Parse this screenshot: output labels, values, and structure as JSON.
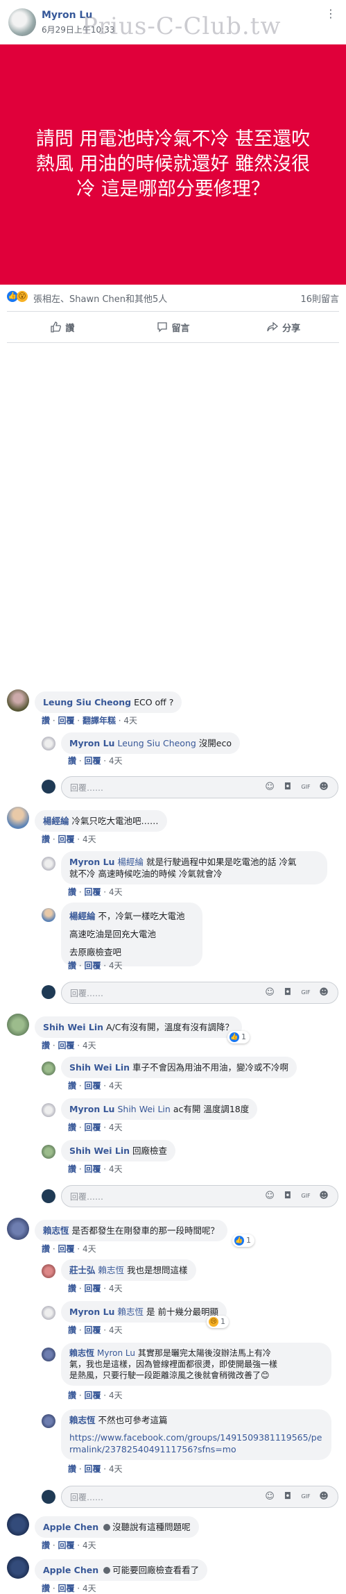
{
  "watermark": "Prius-C-Club.tw",
  "post": {
    "author": "Myron Lu",
    "time": "6月29日上午10:33",
    "text": "請問 用電池時冷氣不冷 甚至還吹熱風 用油的時候就還好 雖然沒很冷 這是哪部分要修理？",
    "bg_color": "#e0003a"
  },
  "reactions": {
    "names": "張相左、Shawn Chen和其他5人",
    "comment_count": "16則留言"
  },
  "actions": {
    "like": "讚",
    "comment": "留言",
    "share": "分享"
  },
  "labels": {
    "like": "讚",
    "reply": "回覆",
    "translate": "翻譯年糕",
    "dot": "·",
    "reply_placeholder": "回覆……"
  },
  "comments": [
    {
      "author": "Leung Siu Cheong",
      "text": "ECO off ?",
      "time": "4天"
    },
    {
      "author": "Myron Lu",
      "tag": "Leung Siu Cheong",
      "text": "沒開eco",
      "time": "4天"
    },
    {
      "author": "楊經綸",
      "text": "冷氣只吃大電池吧……",
      "time": "4天"
    },
    {
      "author": "Myron Lu",
      "tag": "楊經綸",
      "text_line1": "就是行駛過程中如果是吃電池的話 冷氣",
      "text_line2": "就不冷 高速時候吃油的時候 冷氣就會冷",
      "time": "4天"
    },
    {
      "author": "楊經綸",
      "text_line1": "不，冷氣一樣吃大電池",
      "text_line2": "高速吃油是回充大電池",
      "text_line3": "去原廠檢查吧",
      "time": "4天"
    },
    {
      "author": "Shih Wei Lin",
      "text": "A/C有沒有開，溫度有沒有調降？",
      "time": "4天",
      "likes": "1"
    },
    {
      "author": "Shih Wei Lin",
      "text": "車子不會因為用油不用油，變冷或不冷啊",
      "time": "4天"
    },
    {
      "author": "Myron Lu",
      "tag": "Shih Wei Lin",
      "text": "ac有開 溫度調18度",
      "time": "4天"
    },
    {
      "author": "Shih Wei Lin",
      "text": "回廠檢查",
      "time": "4天"
    },
    {
      "author": "賴志恆",
      "text": "是否都發生在剛發車的那一段時間呢？",
      "time": "4天",
      "likes": "1"
    },
    {
      "author": "莊士弘",
      "tag": "賴志恆",
      "text": "我也是想問這樣",
      "time": "4天"
    },
    {
      "author": "Myron Lu",
      "tag": "賴志恆",
      "text": "是 前十幾分最明顯",
      "time": "4天",
      "sad": "1"
    },
    {
      "author": "賴志恆",
      "tag": "Myron Lu",
      "text_line1": "其實那是曬完太陽後沒辦法馬上有冷",
      "text_line2": "氣，我也是這樣，因為管線裡面都很燙，即使開最強一樣",
      "text_line3": "是熱風，只要行駛一段距離涼風之後就會稍微改善了😊",
      "time": "4天"
    },
    {
      "author": "賴志恆",
      "text": "不然也可參考這篇",
      "link_line1": "https://www.facebook.com/groups/1491509381119565/pe",
      "link_line2": "rmalink/2378254049111756?sfns=mo",
      "time": "4天"
    },
    {
      "author": "Apple Chen",
      "text": "沒聽說有這種問題呢",
      "time": "4天"
    },
    {
      "author": "Apple Chen",
      "text": "可能要回廠檢查看看了",
      "time": "4天"
    }
  ]
}
